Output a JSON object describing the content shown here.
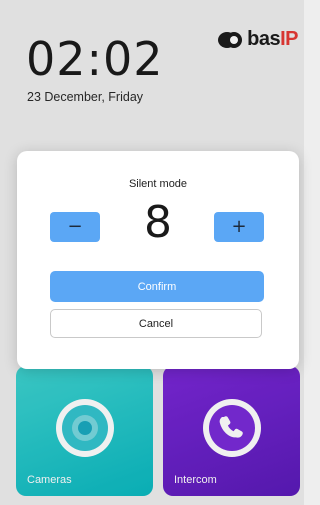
{
  "header": {
    "time": "02:02",
    "date": "23 December, Friday",
    "logo": {
      "text_main": "bas",
      "text_accent": "IP",
      "accent_color": "#e53935"
    }
  },
  "tiles": [
    {
      "label": "Cameras",
      "icon": "camera-lens-icon",
      "color": "#1ec3c6"
    },
    {
      "label": "Intercom",
      "icon": "phone-icon",
      "color": "#6a22c8"
    }
  ],
  "modal": {
    "title": "Silent mode",
    "value": "8",
    "decrement_label": "−",
    "increment_label": "+",
    "confirm_label": "Confirm",
    "cancel_label": "Cancel",
    "accent_color": "#5ba7f5"
  }
}
